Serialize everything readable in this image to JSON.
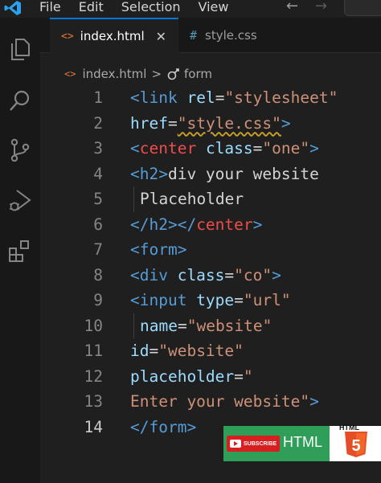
{
  "menu": {
    "items": [
      "File",
      "Edit",
      "Selection",
      "View"
    ],
    "back_arrow": "←",
    "forward_arrow": "→"
  },
  "activity_bar": {
    "icons": [
      "explorer-icon",
      "search-icon",
      "source-control-icon",
      "run-debug-icon",
      "extensions-icon"
    ]
  },
  "tabs": [
    {
      "label": "index.html",
      "glyph": "<>",
      "active": true,
      "close": "✕"
    },
    {
      "label": "style.css",
      "glyph": "#",
      "active": false
    }
  ],
  "breadcrumb": {
    "file": "index.html",
    "separator": ">",
    "symbol": "form"
  },
  "editor": {
    "current_line": 14,
    "lines": [
      {
        "n": "1",
        "t": [
          [
            "tag",
            "<link "
          ],
          [
            "attr",
            "rel"
          ],
          [
            "txt",
            "="
          ],
          [
            "str",
            "\"stylesheet\""
          ]
        ]
      },
      {
        "n": "2",
        "t": [
          [
            "attr",
            "href"
          ],
          [
            "txt",
            "="
          ],
          [
            "str",
            "\"style.css\""
          ],
          [
            "tag",
            ">"
          ]
        ]
      },
      {
        "n": "3",
        "t": [
          [
            "tag",
            "<"
          ],
          [
            "tag-red",
            "center "
          ],
          [
            "attr",
            "class"
          ],
          [
            "txt",
            "="
          ],
          [
            "str",
            "\"one\""
          ],
          [
            "tag",
            ">"
          ]
        ]
      },
      {
        "n": "4",
        "t": [
          [
            "tag",
            "<h2>"
          ],
          [
            "txt",
            "div your website"
          ]
        ]
      },
      {
        "n": "5",
        "t": [
          [
            "txt",
            "Placeholder"
          ]
        ],
        "indent": true
      },
      {
        "n": "6",
        "t": [
          [
            "tag",
            "</h2></"
          ],
          [
            "tag-red",
            "center"
          ],
          [
            "tag",
            ">"
          ]
        ]
      },
      {
        "n": "7",
        "t": [
          [
            "tag",
            "<form>"
          ]
        ]
      },
      {
        "n": "8",
        "t": [
          [
            "tag",
            "<div "
          ],
          [
            "attr",
            "class"
          ],
          [
            "txt",
            "="
          ],
          [
            "str",
            "\"co\""
          ],
          [
            "tag",
            ">"
          ]
        ]
      },
      {
        "n": "9",
        "t": [
          [
            "tag",
            "<input "
          ],
          [
            "attr",
            "type"
          ],
          [
            "txt",
            "="
          ],
          [
            "str",
            "\"url\""
          ]
        ]
      },
      {
        "n": "10",
        "t": [
          [
            "attr",
            "name"
          ],
          [
            "txt",
            "="
          ],
          [
            "str",
            "\"website\""
          ]
        ],
        "indent": true
      },
      {
        "n": "11",
        "t": [
          [
            "attr",
            "id"
          ],
          [
            "txt",
            "="
          ],
          [
            "str",
            "\"website\""
          ]
        ]
      },
      {
        "n": "12",
        "t": [
          [
            "attr",
            "placeholder"
          ],
          [
            "txt",
            "="
          ],
          [
            "str",
            "\""
          ]
        ]
      },
      {
        "n": "13",
        "t": [
          [
            "str",
            "Enter your website\""
          ],
          [
            "tag",
            ">"
          ]
        ]
      },
      {
        "n": "14",
        "t": [
          [
            "tag",
            "</form>"
          ]
        ]
      }
    ]
  },
  "banner": {
    "subscribe_label": "SUBSCRIBE",
    "html_label": "HTML",
    "logo_text": "HTML",
    "logo_digit": "5"
  },
  "colors": {
    "tag": "#569cd6",
    "attr": "#9cdcfe",
    "string": "#ce9178",
    "center_tag": "#f14c4c",
    "accent": "#0078d4"
  }
}
